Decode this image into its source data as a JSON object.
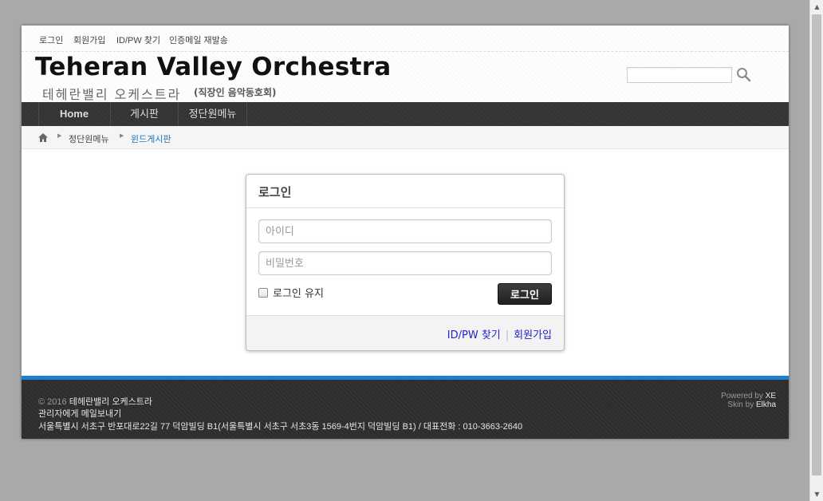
{
  "gnb": {
    "login": "로그인",
    "signup": "회원가입",
    "find_id_pw": "ID/PW 찾기",
    "resend_auth": "인증메일 재발송"
  },
  "header": {
    "title_en": "Teheran Valley Orchestra",
    "title_ko": "테헤란밸리 오케스트라",
    "subtitle": "(직장인 음악동호회)",
    "search_placeholder": "",
    "search_icon": "magnifier-icon"
  },
  "nav": {
    "items": [
      {
        "label": "Home"
      },
      {
        "label": "게시판"
      },
      {
        "label": "정단원메뉴"
      }
    ]
  },
  "breadcrumb": {
    "home_icon": "home-icon",
    "items": [
      {
        "label": "정단원메뉴"
      },
      {
        "label": "윈드게시판"
      }
    ]
  },
  "login": {
    "title": "로그인",
    "id_placeholder": "아이디",
    "pw_placeholder": "비밀번호",
    "keep_label": "로그인 유지",
    "keep_checked": false,
    "submit_label": "로그인",
    "find_link": "ID/PW 찾기",
    "separator": "|",
    "signup_link": "회원가입"
  },
  "footer": {
    "copyright_year": "© 2016",
    "copyright_name": "테헤란밸리 오케스트라",
    "mail_link": "관리자에게 메일보내기",
    "address": "서울특별시 서초구 반포대로22길 77 덕암빌딩 B1(서울특별시 서초구 서초3동 1569-4번지 덕암빌딩 B1) / 대표전화 : 010-3663-2640",
    "powered_by_label": "Powered by",
    "powered_by_value": "XE",
    "skin_by_label": "Skin by",
    "skin_by_value": "Elkha"
  },
  "colors": {
    "accent_blue": "#1b7fd2",
    "nav_bg": "#333333",
    "link_blue": "#2222c8",
    "breadcrumb_active": "#1b75bb"
  }
}
